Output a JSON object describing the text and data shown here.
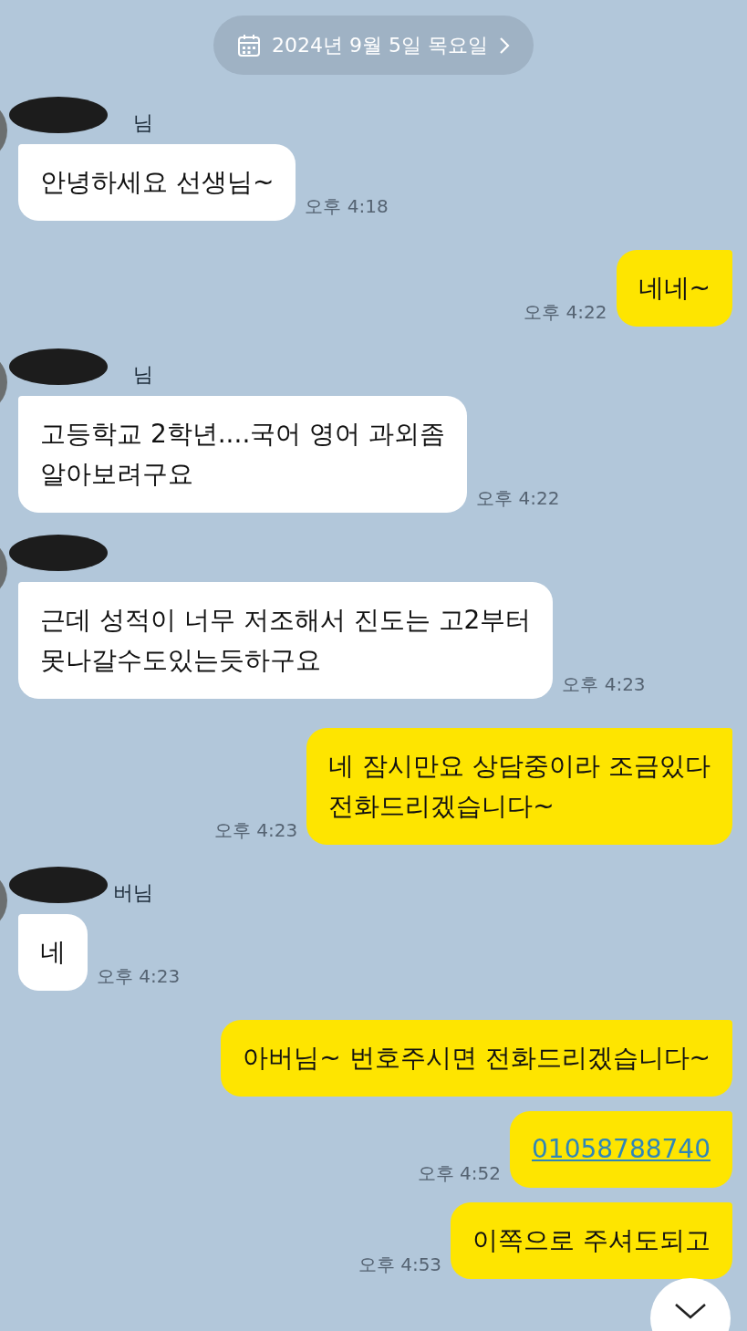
{
  "date_divider": {
    "label": "2024년 9월 5일 목요일"
  },
  "messages": [
    {
      "kind": "received",
      "sender": "님",
      "text": "안녕하세요 선생님~",
      "time": "오후 4:18"
    },
    {
      "kind": "sent",
      "text": "네네~",
      "time": "오후 4:22"
    },
    {
      "kind": "received",
      "sender": "님",
      "text": "고등학교 2학년....국어 영어 과외좀\n알아보려구요",
      "time": "오후 4:22"
    },
    {
      "kind": "received",
      "text": "근데 성적이 너무 저조해서 진도는 고2부터\n못나갈수도있는듯하구요",
      "time": "오후 4:23"
    },
    {
      "kind": "sent",
      "text": "네 잠시만요 상담중이라 조금있다\n전화드리겠습니다~",
      "time": "오후 4:23"
    },
    {
      "kind": "received",
      "sender": "버님",
      "text": "네",
      "time": "오후 4:23"
    },
    {
      "kind": "sent",
      "text": "아버님~ 번호주시면 전화드리겠습니다~"
    },
    {
      "kind": "link",
      "text": "01058788740",
      "time": "오후 4:52"
    },
    {
      "kind": "sent",
      "text": "이쪽으로 주셔도되고",
      "time": "오후 4:53"
    }
  ]
}
